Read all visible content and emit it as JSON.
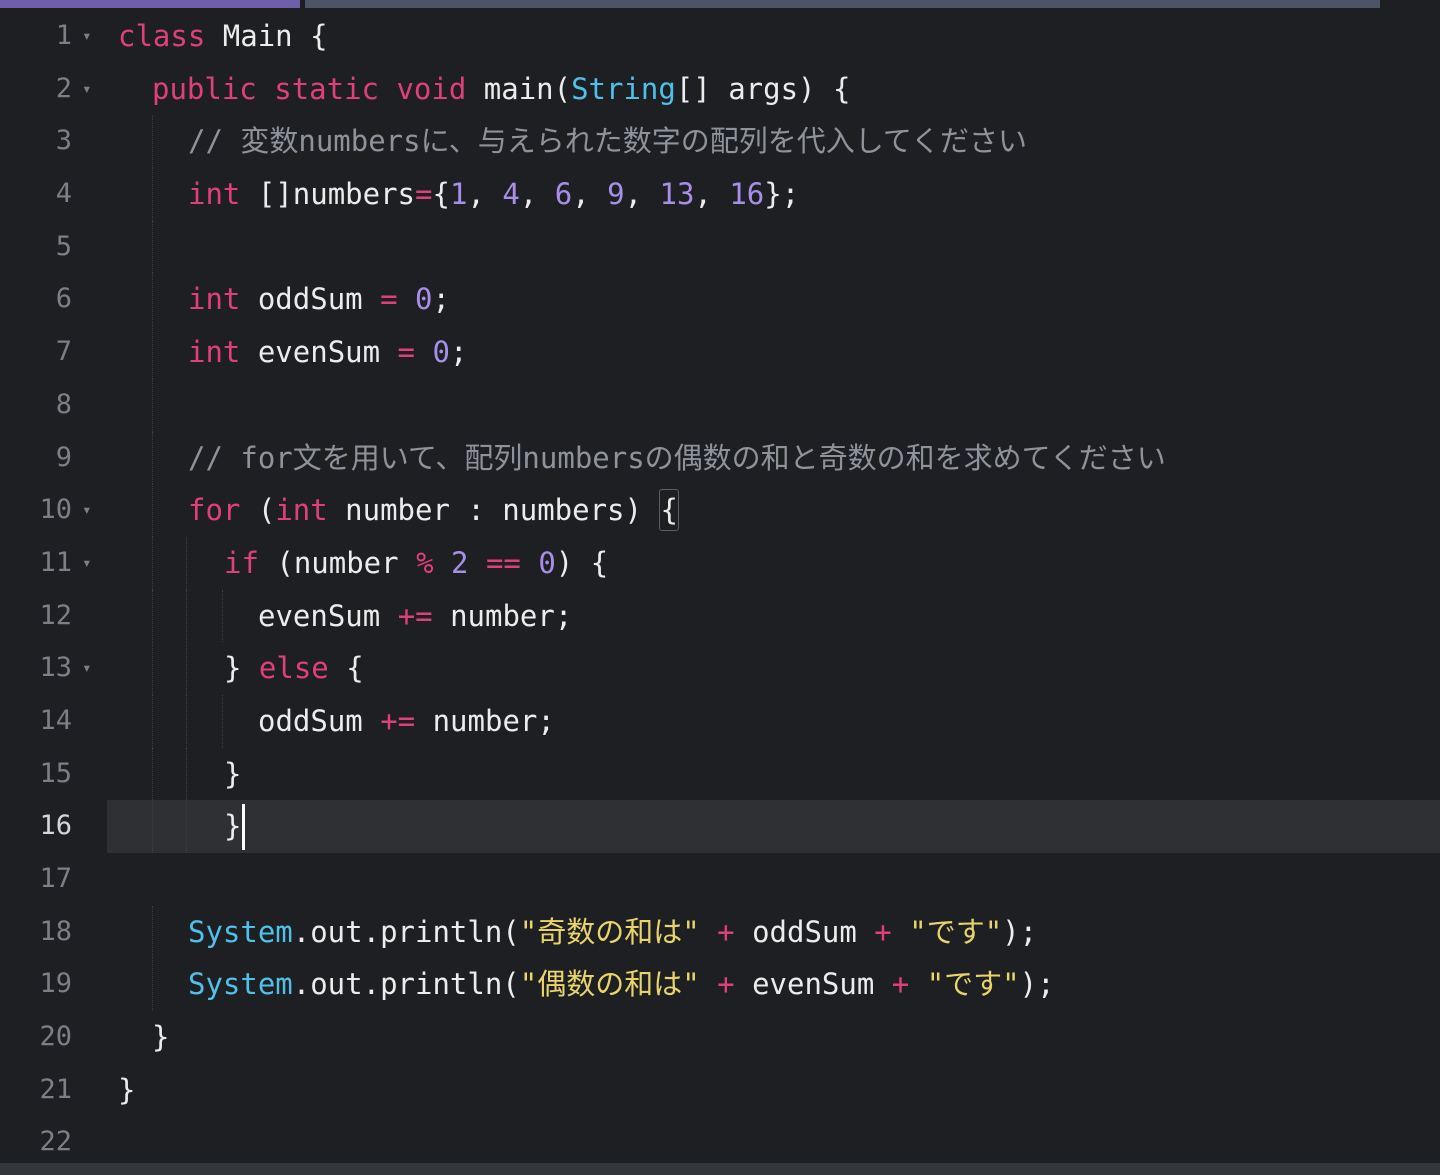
{
  "editor": {
    "colors": {
      "background": "#1e1f22",
      "current_line": "#2f3034",
      "keyword": "#e0407a",
      "type": "#4fc1e9",
      "number": "#a98ee8",
      "string": "#e8d46a",
      "comment": "#8f929a",
      "line_number": "#7c7f86"
    },
    "current_line": 16,
    "lines": [
      {
        "n": "1",
        "fold": true,
        "tokens": [
          [
            "kw",
            "class"
          ],
          [
            "plain",
            " Main {"
          ]
        ]
      },
      {
        "n": "2",
        "fold": true,
        "tokens": [
          [
            "kw",
            "public"
          ],
          [
            "plain",
            " "
          ],
          [
            "kw",
            "static"
          ],
          [
            "plain",
            " "
          ],
          [
            "kw",
            "void"
          ],
          [
            "plain",
            " main("
          ],
          [
            "type",
            "String"
          ],
          [
            "plain",
            "[] args) {"
          ]
        ]
      },
      {
        "n": "3",
        "fold": false,
        "tokens": [
          [
            "cm",
            "// 変数numbersに、与えられた数字の配列を代入してください"
          ]
        ]
      },
      {
        "n": "4",
        "fold": false,
        "tokens": [
          [
            "kw",
            "int"
          ],
          [
            "plain",
            " []numbers"
          ],
          [
            "op",
            "="
          ],
          [
            "plain",
            "{"
          ],
          [
            "num",
            "1"
          ],
          [
            "plain",
            ", "
          ],
          [
            "num",
            "4"
          ],
          [
            "plain",
            ", "
          ],
          [
            "num",
            "6"
          ],
          [
            "plain",
            ", "
          ],
          [
            "num",
            "9"
          ],
          [
            "plain",
            ", "
          ],
          [
            "num",
            "13"
          ],
          [
            "plain",
            ", "
          ],
          [
            "num",
            "16"
          ],
          [
            "plain",
            "};"
          ]
        ]
      },
      {
        "n": "5",
        "fold": false,
        "tokens": []
      },
      {
        "n": "6",
        "fold": false,
        "tokens": [
          [
            "kw",
            "int"
          ],
          [
            "plain",
            " oddSum "
          ],
          [
            "op",
            "="
          ],
          [
            "plain",
            " "
          ],
          [
            "num",
            "0"
          ],
          [
            "plain",
            ";"
          ]
        ]
      },
      {
        "n": "7",
        "fold": false,
        "tokens": [
          [
            "kw",
            "int"
          ],
          [
            "plain",
            " evenSum "
          ],
          [
            "op",
            "="
          ],
          [
            "plain",
            " "
          ],
          [
            "num",
            "0"
          ],
          [
            "plain",
            ";"
          ]
        ]
      },
      {
        "n": "8",
        "fold": false,
        "tokens": []
      },
      {
        "n": "9",
        "fold": false,
        "tokens": [
          [
            "cm",
            "// for文を用いて、配列numbersの偶数の和と奇数の和を求めてください"
          ]
        ]
      },
      {
        "n": "10",
        "fold": true,
        "tokens": [
          [
            "kw",
            "for"
          ],
          [
            "plain",
            " ("
          ],
          [
            "kw",
            "int"
          ],
          [
            "plain",
            " number : numbers) "
          ],
          [
            "plainbox",
            "{"
          ]
        ]
      },
      {
        "n": "11",
        "fold": true,
        "tokens": [
          [
            "kw",
            "if"
          ],
          [
            "plain",
            " (number "
          ],
          [
            "op",
            "%"
          ],
          [
            "plain",
            " "
          ],
          [
            "num",
            "2"
          ],
          [
            "plain",
            " "
          ],
          [
            "op",
            "=="
          ],
          [
            "plain",
            " "
          ],
          [
            "num",
            "0"
          ],
          [
            "plain",
            ") {"
          ]
        ]
      },
      {
        "n": "12",
        "fold": false,
        "tokens": [
          [
            "plain",
            "evenSum "
          ],
          [
            "op",
            "+="
          ],
          [
            "plain",
            " number;"
          ]
        ]
      },
      {
        "n": "13",
        "fold": true,
        "tokens": [
          [
            "plain",
            "} "
          ],
          [
            "kw",
            "else"
          ],
          [
            "plain",
            " {"
          ]
        ]
      },
      {
        "n": "14",
        "fold": false,
        "tokens": [
          [
            "plain",
            "oddSum "
          ],
          [
            "op",
            "+="
          ],
          [
            "plain",
            " number;"
          ]
        ]
      },
      {
        "n": "15",
        "fold": false,
        "tokens": [
          [
            "plain",
            "}"
          ]
        ]
      },
      {
        "n": "16",
        "fold": false,
        "tokens": [
          [
            "plain",
            "}"
          ]
        ]
      },
      {
        "n": "17",
        "fold": false,
        "tokens": []
      },
      {
        "n": "18",
        "fold": false,
        "tokens": [
          [
            "type",
            "System"
          ],
          [
            "plain",
            ".out.println("
          ],
          [
            "str",
            "\"奇数の和は\""
          ],
          [
            "plain",
            " "
          ],
          [
            "op",
            "+"
          ],
          [
            "plain",
            " oddSum "
          ],
          [
            "op",
            "+"
          ],
          [
            "plain",
            " "
          ],
          [
            "str",
            "\"です\""
          ],
          [
            "plain",
            ");"
          ]
        ]
      },
      {
        "n": "19",
        "fold": false,
        "tokens": [
          [
            "type",
            "System"
          ],
          [
            "plain",
            ".out.println("
          ],
          [
            "str",
            "\"偶数の和は\""
          ],
          [
            "plain",
            " "
          ],
          [
            "op",
            "+"
          ],
          [
            "plain",
            " evenSum "
          ],
          [
            "op",
            "+"
          ],
          [
            "plain",
            " "
          ],
          [
            "str",
            "\"です\""
          ],
          [
            "plain",
            ");"
          ]
        ]
      },
      {
        "n": "20",
        "fold": false,
        "tokens": [
          [
            "plain",
            "}"
          ]
        ]
      },
      {
        "n": "21",
        "fold": false,
        "tokens": [
          [
            "plain",
            "}"
          ]
        ]
      },
      {
        "n": "22",
        "fold": false,
        "tokens": []
      }
    ]
  }
}
